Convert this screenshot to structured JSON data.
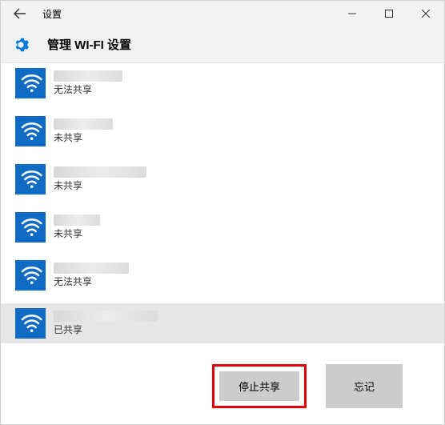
{
  "titlebar": {
    "back": "←",
    "title": "设置",
    "minimize": "—",
    "maximize": "☐",
    "close": "✕"
  },
  "header": {
    "title": "管理 WI-FI 设置"
  },
  "networks": [
    {
      "name": "",
      "status": "无法共享",
      "blur_w": 86
    },
    {
      "name": "",
      "status": "未共享",
      "blur_w": 74
    },
    {
      "name": "",
      "status": "未共享",
      "blur_w": 116
    },
    {
      "name": "",
      "status": "未共享",
      "blur_w": 58
    },
    {
      "name": "",
      "status": "无法共享",
      "blur_w": 94
    },
    {
      "name": "",
      "status": "已共享",
      "blur_w": 130,
      "selected": true
    }
  ],
  "actions": {
    "stop_share": "停止共享",
    "forget": "忘记"
  }
}
